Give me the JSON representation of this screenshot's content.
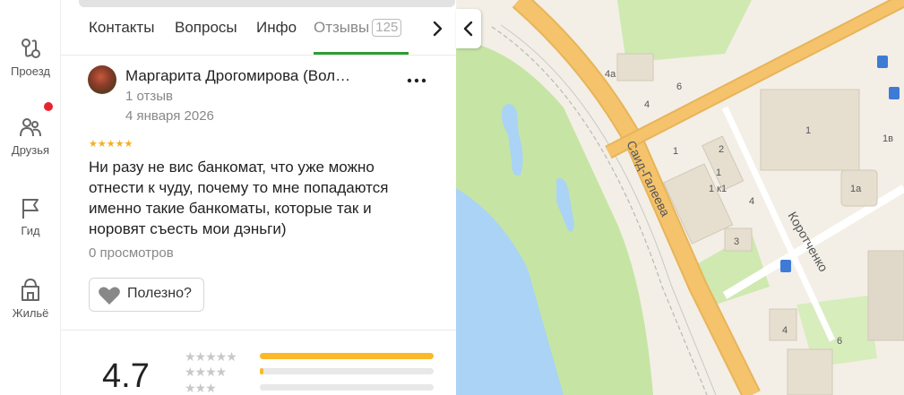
{
  "rail": {
    "items": [
      {
        "label": "Проезд",
        "icon": "route-icon"
      },
      {
        "label": "Друзья",
        "icon": "friends-icon"
      },
      {
        "label": "Гид",
        "icon": "flag-icon"
      },
      {
        "label": "Жильё",
        "icon": "housing-icon"
      }
    ]
  },
  "tabs": {
    "items": [
      "Контакты",
      "Вопросы",
      "Инфо"
    ],
    "active_label": "Отзывы",
    "active_count": "125"
  },
  "review": {
    "author": "Маргарита Дрогомирова (Вол…",
    "reviews_count": "1 отзыв",
    "date": "4 января 2026",
    "stars": "★★★★★",
    "text": "Ни разу не вис банкомат, что уже можно отнести к чуду, почему то мне попадаются именно такие банкоматы, которые так и норовят съесть мои дэньги)",
    "views": "0 просмотров",
    "helpful_label": "Полезно?"
  },
  "summary": {
    "rating": "4.7",
    "distribution": [
      {
        "stars": "★★★★★",
        "fraction": 1.0
      },
      {
        "stars": "★★★★",
        "fraction": 0.02
      },
      {
        "stars": "★★★",
        "fraction": 0.0
      }
    ]
  },
  "map": {
    "street_1": "Саид-Галеева",
    "street_2": "Коротченко",
    "houses": [
      "4а",
      "6",
      "4",
      "1",
      "2",
      "1",
      "1 к1",
      "4",
      "3",
      "1",
      "1в",
      "1а",
      "4",
      "6"
    ]
  },
  "colors": {
    "accent_green": "#2e9d2e",
    "star_yellow": "#f2b01e",
    "bar_yellow": "#fbb928",
    "notify_red": "#e8232f",
    "road": "#f5c36b",
    "park": "#c6e5a4",
    "water": "#aad3f5"
  }
}
